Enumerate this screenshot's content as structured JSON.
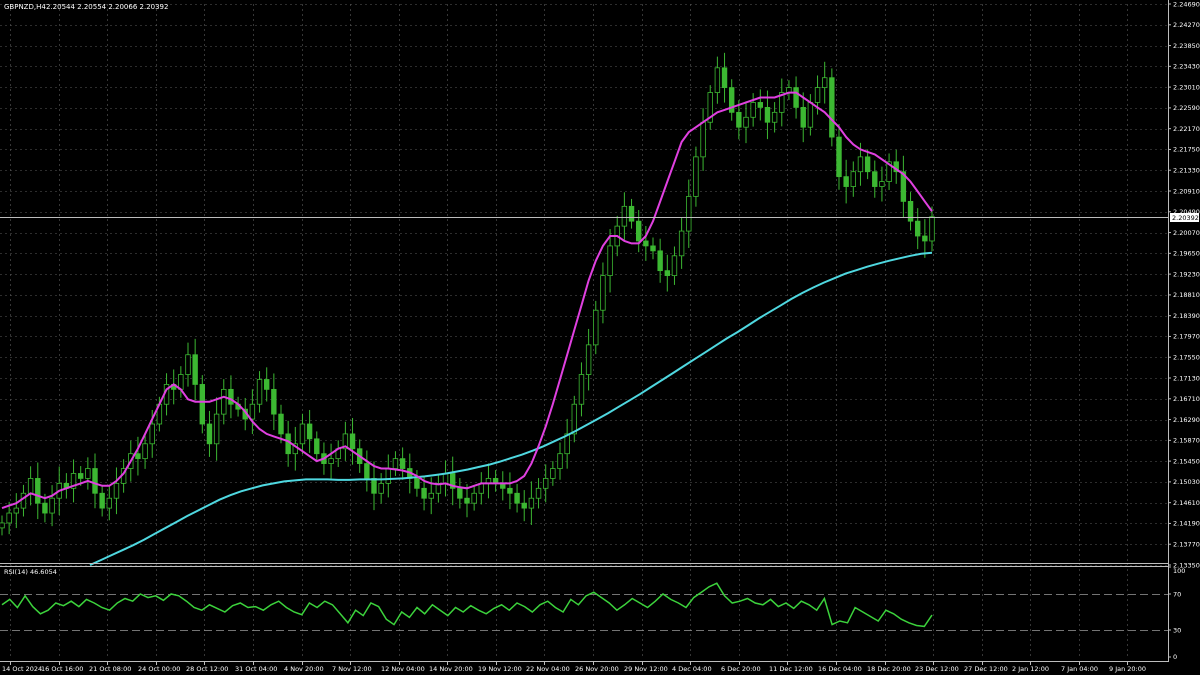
{
  "window": {
    "symbol_label": "GBPNZD,H4",
    "ohlc_label": "2.20544 2.20554 2.20066 2.20392",
    "current_price": "2.20392"
  },
  "chart_data": {
    "type": "line",
    "price_panel": {
      "ylim": [
        2.1335,
        2.2469
      ],
      "y_ticks": [
        "2.24690",
        "2.24270",
        "2.23850",
        "2.23430",
        "2.23010",
        "2.22590",
        "2.22170",
        "2.21750",
        "2.21330",
        "2.20910",
        "2.20490",
        "2.20070",
        "2.19650",
        "2.19230",
        "2.18810",
        "2.18390",
        "2.17970",
        "2.17550",
        "2.17130",
        "2.16710",
        "2.16290",
        "2.15870",
        "2.15450",
        "2.15030",
        "2.14610",
        "2.14190",
        "2.13770",
        "2.13350"
      ],
      "close": [
        2.142,
        2.144,
        2.145,
        2.148,
        2.151,
        2.146,
        2.144,
        2.147,
        2.15,
        2.149,
        2.152,
        2.151,
        2.153,
        2.148,
        2.145,
        2.147,
        2.15,
        2.153,
        2.156,
        2.155,
        2.158,
        2.162,
        2.166,
        2.17,
        2.169,
        2.172,
        2.176,
        2.17,
        2.162,
        2.158,
        2.164,
        2.169,
        2.166,
        2.165,
        2.163,
        2.166,
        2.171,
        2.169,
        2.164,
        2.16,
        2.156,
        2.158,
        2.162,
        2.159,
        2.156,
        2.154,
        2.155,
        2.157,
        2.16,
        2.157,
        2.154,
        2.151,
        2.148,
        2.15,
        2.153,
        2.155,
        2.153,
        2.151,
        2.149,
        2.147,
        2.148,
        2.15,
        2.152,
        2.149,
        2.147,
        2.146,
        2.148,
        2.15,
        2.151,
        2.15,
        2.149,
        2.148,
        2.146,
        2.145,
        2.147,
        2.149,
        2.151,
        2.153,
        2.156,
        2.16,
        2.166,
        2.172,
        2.178,
        2.185,
        2.192,
        2.198,
        2.202,
        2.206,
        2.203,
        2.199,
        2.198,
        2.197,
        2.193,
        2.192,
        2.196,
        2.201,
        2.208,
        2.216,
        2.223,
        2.229,
        2.234,
        2.23,
        2.225,
        2.222,
        2.224,
        2.227,
        2.226,
        2.223,
        2.225,
        2.229,
        2.23,
        2.226,
        2.222,
        2.227,
        2.23,
        2.232,
        2.22,
        2.212,
        2.21,
        2.213,
        2.216,
        2.213,
        2.21,
        2.211,
        2.215,
        2.213,
        2.207,
        2.203,
        2.2,
        2.199,
        2.2039
      ],
      "ma_fast": [
        2.145,
        2.1455,
        2.146,
        2.147,
        2.148,
        2.1475,
        2.147,
        2.1475,
        2.1485,
        2.149,
        2.1495,
        2.15,
        2.1505,
        2.15,
        2.1495,
        2.1495,
        2.1505,
        2.152,
        2.1545,
        2.157,
        2.16,
        2.163,
        2.166,
        2.169,
        2.17,
        2.169,
        2.167,
        2.1665,
        2.1665,
        2.1665,
        2.167,
        2.1675,
        2.167,
        2.166,
        2.1645,
        2.1625,
        2.161,
        2.16,
        2.1595,
        2.159,
        2.1585,
        2.1575,
        2.1565,
        2.1555,
        2.1545,
        2.155,
        2.156,
        2.157,
        2.1575,
        2.1565,
        2.1555,
        2.1545,
        2.1535,
        2.153,
        2.153,
        2.1528,
        2.1526,
        2.1522,
        2.1515,
        2.1505,
        2.15,
        2.1498,
        2.15,
        2.1495,
        2.1492,
        2.149,
        2.1495,
        2.15,
        2.15,
        2.15,
        2.15,
        2.15,
        2.1505,
        2.1515,
        2.154,
        2.1575,
        2.1615,
        2.166,
        2.171,
        2.176,
        2.181,
        2.186,
        2.191,
        2.195,
        2.198,
        2.2,
        2.2,
        2.199,
        2.1985,
        2.1985,
        2.2,
        2.203,
        2.207,
        2.211,
        2.215,
        2.219,
        2.221,
        2.222,
        2.223,
        2.224,
        2.225,
        2.2255,
        2.226,
        2.2265,
        2.227,
        2.2275,
        2.228,
        2.228,
        2.228,
        2.2285,
        2.229,
        2.229,
        2.228,
        2.227,
        2.226,
        2.225,
        2.2235,
        2.222,
        2.22,
        2.2185,
        2.2175,
        2.217,
        2.2165,
        2.2155,
        2.2145,
        2.2135,
        2.2125,
        2.211,
        2.209,
        2.207,
        2.205
      ],
      "ma_slow": [
        2.1335,
        2.1345,
        2.1355,
        2.1365,
        2.1375,
        2.1386,
        2.1398,
        2.141,
        2.1422,
        2.1434,
        2.1445,
        2.1456,
        2.1467,
        2.1476,
        2.1484,
        2.149,
        2.1496,
        2.15,
        2.1504,
        2.1506,
        2.1508,
        2.1508,
        2.1508,
        2.1507,
        2.1507,
        2.1508,
        2.1508,
        2.1508,
        2.1509,
        2.151,
        2.1512,
        2.1514,
        2.1517,
        2.152,
        2.1524,
        2.1528,
        2.1533,
        2.1538,
        2.1544,
        2.1551,
        2.1558,
        2.1566,
        2.1575,
        2.1585,
        2.1595,
        2.1606,
        2.1618,
        2.163,
        2.1642,
        2.1655,
        2.1668,
        2.1681,
        2.1695,
        2.1709,
        2.1723,
        2.1737,
        2.1751,
        2.1765,
        2.1779,
        2.1793,
        2.1806,
        2.182,
        2.1834,
        2.1847,
        2.186,
        2.1873,
        2.1885,
        2.1896,
        2.1906,
        2.1915,
        2.1924,
        2.1931,
        2.1938,
        2.1944,
        2.195,
        2.1955,
        2.196,
        2.1964,
        2.1966
      ],
      "colors": {
        "candles": "#3cb832",
        "ma_fast": "#e040e0",
        "ma_slow": "#4fd8e0"
      }
    },
    "rsi_panel": {
      "label": "RSI(14) 46.6054",
      "ylim": [
        0,
        100
      ],
      "levels": [
        70,
        30
      ],
      "y_ticks": [
        "100",
        "70",
        "30",
        "0"
      ],
      "values": [
        58,
        64,
        55,
        68,
        56,
        48,
        52,
        60,
        57,
        62,
        56,
        64,
        60,
        55,
        52,
        60,
        65,
        62,
        70,
        66,
        68,
        63,
        70,
        68,
        62,
        55,
        52,
        58,
        54,
        50,
        57,
        60,
        55,
        56,
        52,
        58,
        62,
        55,
        50,
        47,
        60,
        55,
        62,
        58,
        48,
        38,
        52,
        46,
        60,
        56,
        42,
        36,
        50,
        44,
        55,
        48,
        58,
        52,
        46,
        55,
        50,
        57,
        52,
        48,
        54,
        58,
        52,
        60,
        56,
        50,
        58,
        62,
        55,
        50,
        64,
        58,
        68,
        72,
        66,
        60,
        52,
        58,
        65,
        60,
        55,
        62,
        70,
        64,
        60,
        55,
        66,
        72,
        78,
        82,
        68,
        60,
        62,
        65,
        60,
        58,
        64,
        56,
        60,
        54,
        62,
        58,
        52,
        65,
        36,
        40,
        38,
        55,
        50,
        45,
        40,
        52,
        48,
        42,
        38,
        35,
        34,
        46.6
      ],
      "color": "#3cd23c"
    },
    "x_tick_labels": [
      "14 Oct 2024",
      "16 Oct 16:00",
      "21 Oct 08:00",
      "24 Oct 00:00",
      "28 Oct 12:00",
      "31 Oct 04:00",
      "4 Nov 20:00",
      "7 Nov 12:00",
      "12 Nov 04:00",
      "14 Nov 20:00",
      "19 Nov 12:00",
      "22 Nov 04:00",
      "26 Nov 20:00",
      "29 Nov 12:00",
      "4 Dec 04:00",
      "6 Dec 20:00",
      "11 Dec 12:00",
      "16 Dec 04:00",
      "18 Dec 20:00",
      "23 Dec 12:00",
      "27 Dec 12:00",
      "2 Jan 12:00",
      "7 Jan 04:00",
      "9 Jan 20:00"
    ]
  }
}
